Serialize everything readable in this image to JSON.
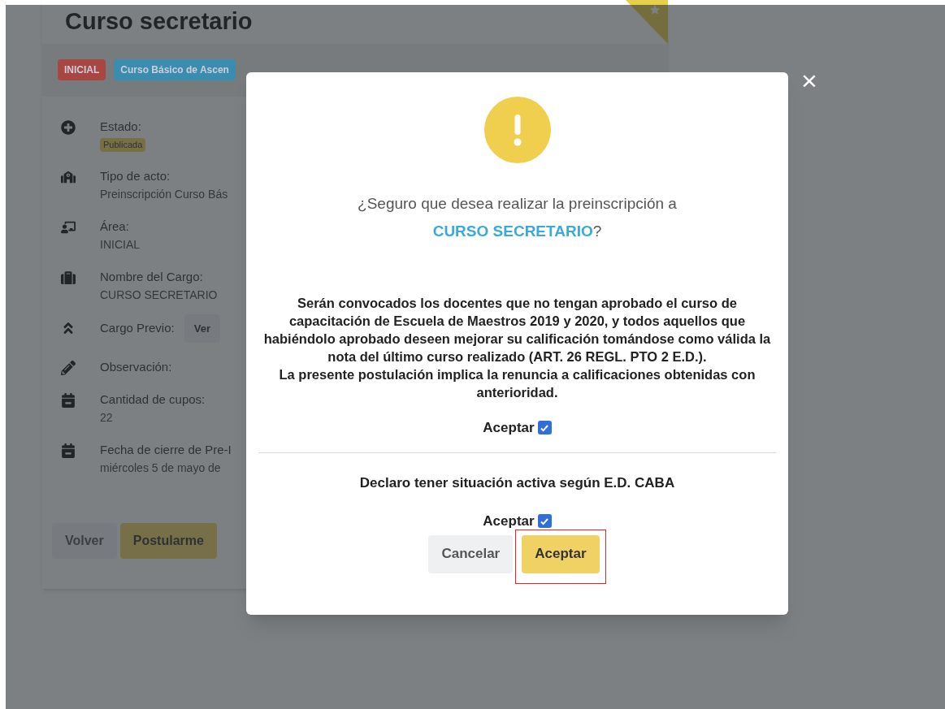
{
  "page": {
    "title": "Curso secretario",
    "badges": [
      {
        "label": "INICIAL",
        "color": "#a84643"
      },
      {
        "label": "Curso Básico de Ascen",
        "color": "#3b8db0"
      }
    ],
    "details": [
      {
        "kind": "badge",
        "label": "Estado:",
        "value": "Publicada"
      },
      {
        "kind": "value",
        "label": "Tipo de acto:",
        "value": "Preinscripción Curso Bás"
      },
      {
        "kind": "value",
        "label": "Área:",
        "value": "INICIAL"
      },
      {
        "kind": "value",
        "label": "Nombre del Cargo:",
        "value": "CURSO SECRETARIO"
      },
      {
        "kind": "button",
        "label": "Cargo Previo:",
        "value": "Ver"
      },
      {
        "kind": "label",
        "label": "Observación:"
      },
      {
        "kind": "value",
        "label": "Cantidad de cupos:",
        "value": "22"
      },
      {
        "kind": "value",
        "label": "Fecha de cierre de Pre-I",
        "value": "miércoles 5 de mayo de"
      }
    ],
    "buttons": [
      {
        "label": "Volver",
        "kind": "secondary"
      },
      {
        "label": "Postularme",
        "kind": "primary"
      }
    ]
  },
  "modal": {
    "close": "×",
    "question": "¿Seguro que desea realizar la preinscripción a",
    "course": "CURSO SECRETARIO",
    "question_end": "?",
    "notice": [
      "Serán convocados los docentes que no tengan aprobado el curso de capacitación de Escuela de Maestros 2019 y 2020, y todos aquellos que habiéndolo aprobado deseen mejorar su calificación tomándose como válida la nota del último curso realizado (ART. 26 REGL. PTO 2 E.D.).",
      "La presente postulación implica la renuncia a calificaciones obtenidas con anterioridad."
    ],
    "first_accept": {
      "label": "Aceptar",
      "checked": true
    },
    "declaration": "Declaro tener situación activa según E.D. CABA",
    "second_accept": {
      "label": "Aceptar",
      "checked": true
    },
    "buttons": [
      {
        "label": "Cancelar",
        "kind": "secondary",
        "highlighted": false
      },
      {
        "label": "Aceptar",
        "kind": "primary",
        "highlighted": true
      }
    ]
  }
}
